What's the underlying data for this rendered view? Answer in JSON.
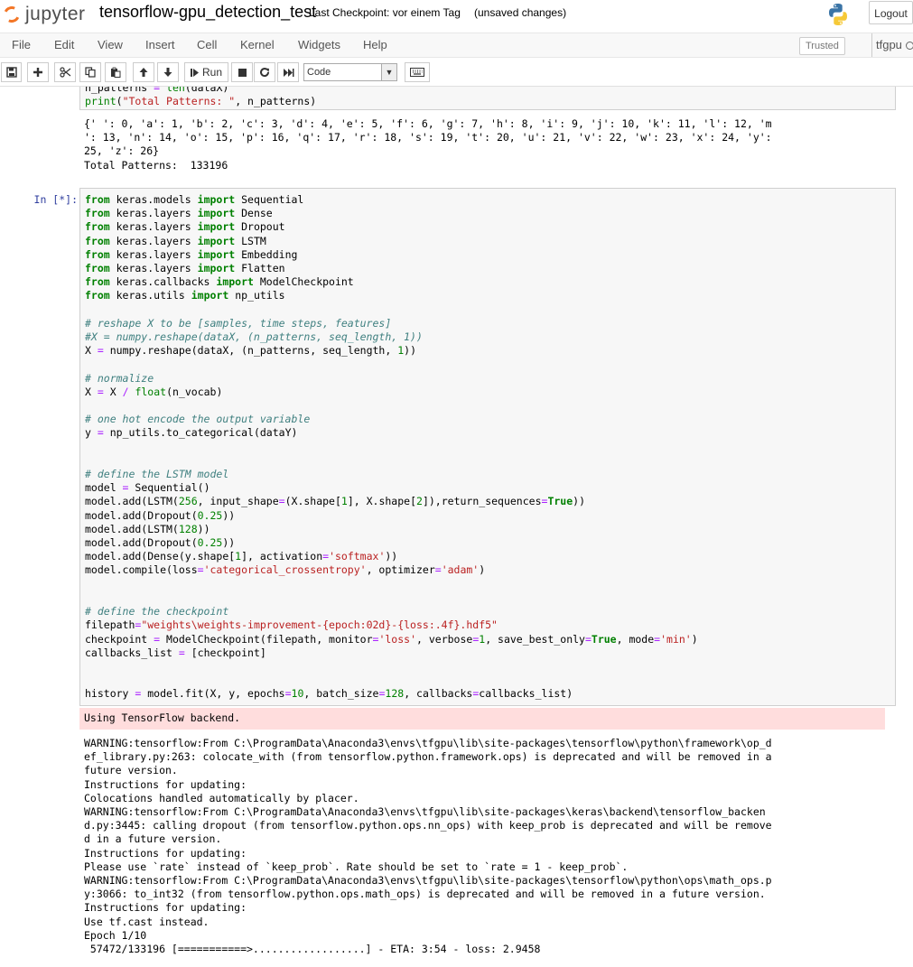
{
  "header": {
    "logo_text": "jupyter",
    "notebook_name": "tensorflow-gpu_detection_test",
    "checkpoint_text": "Last Checkpoint: vor einem Tag",
    "autosave_status": "(unsaved changes)",
    "logout_label": "Logout"
  },
  "menubar": {
    "items": [
      "File",
      "Edit",
      "View",
      "Insert",
      "Cell",
      "Kernel",
      "Widgets",
      "Help"
    ],
    "trusted_label": "Trusted",
    "kernel_name": "tfgpu"
  },
  "toolbar": {
    "buttons": [
      "save-icon",
      "add-cell-icon",
      "cut-icon",
      "copy-icon",
      "paste-icon",
      "move-up-icon",
      "move-down-icon",
      "run-icon",
      "stop-icon",
      "restart-icon",
      "fast-forward-icon",
      "keyboard-icon"
    ],
    "run_label": "Run",
    "cell_type": "Code"
  },
  "previous_cell": {
    "code_visible": "n_patterns = len(dataX)\nprint(\"Total Patterns: \", n_patterns)",
    "output": "{' ': 0, 'a': 1, 'b': 2, 'c': 3, 'd': 4, 'e': 5, 'f': 6, 'g': 7, 'h': 8, 'i': 9, 'j': 10, 'k': 11, 'l': 12, 'm\n': 13, 'n': 14, 'o': 15, 'p': 16, 'q': 17, 'r': 18, 's': 19, 't': 20, 'u': 21, 'v': 22, 'w': 23, 'x': 24, 'y':\n25, 'z': 26}\nTotal Patterns:  133196"
  },
  "current_cell": {
    "prompt": "In [*]:",
    "code": "from keras.models import Sequential\nfrom keras.layers import Dense\nfrom keras.layers import Dropout\nfrom keras.layers import LSTM\nfrom keras.layers import Embedding\nfrom keras.layers import Flatten\nfrom keras.callbacks import ModelCheckpoint\nfrom keras.utils import np_utils\n\n# reshape X to be [samples, time steps, features]\n#X = numpy.reshape(dataX, (n_patterns, seq_length, 1))\nX = numpy.reshape(dataX, (n_patterns, seq_length, 1))\n\n# normalize\nX = X / float(n_vocab)\n\n# one hot encode the output variable\ny = np_utils.to_categorical(dataY)\n\n\n# define the LSTM model\nmodel = Sequential()\nmodel.add(LSTM(256, input_shape=(X.shape[1], X.shape[2]),return_sequences=True))\nmodel.add(Dropout(0.25))\nmodel.add(LSTM(128))\nmodel.add(Dropout(0.25))\nmodel.add(Dense(y.shape[1], activation='softmax'))\nmodel.compile(loss='categorical_crossentropy', optimizer='adam')\n\n\n# define the checkpoint\nfilepath=\"weights\\weights-improvement-{epoch:02d}-{loss:.4f}.hdf5\"\ncheckpoint = ModelCheckpoint(filepath, monitor='loss', verbose=1, save_best_only=True, mode='min')\ncallbacks_list = [checkpoint]\n\n\nhistory = model.fit(X, y, epochs=10, batch_size=128, callbacks=callbacks_list)",
    "stderr": "Using TensorFlow backend.",
    "stream_output": "WARNING:tensorflow:From C:\\ProgramData\\Anaconda3\\envs\\tfgpu\\lib\\site-packages\\tensorflow\\python\\framework\\op_d\nef_library.py:263: colocate_with (from tensorflow.python.framework.ops) is deprecated and will be removed in a\nfuture version.\nInstructions for updating:\nColocations handled automatically by placer.\nWARNING:tensorflow:From C:\\ProgramData\\Anaconda3\\envs\\tfgpu\\lib\\site-packages\\keras\\backend\\tensorflow_backen\nd.py:3445: calling dropout (from tensorflow.python.ops.nn_ops) with keep_prob is deprecated and will be remove\nd in a future version.\nInstructions for updating:\nPlease use `rate` instead of `keep_prob`. Rate should be set to `rate = 1 - keep_prob`.\nWARNING:tensorflow:From C:\\ProgramData\\Anaconda3\\envs\\tfgpu\\lib\\site-packages\\tensorflow\\python\\ops\\math_ops.p\ny:3066: to_int32 (from tensorflow.python.ops.math_ops) is deprecated and will be removed in a future version.\nInstructions for updating:\nUse tf.cast instead.\nEpoch 1/10\n 57472/133196 [===========>..................] - ETA: 3:54 - loss: 2.9458"
  }
}
